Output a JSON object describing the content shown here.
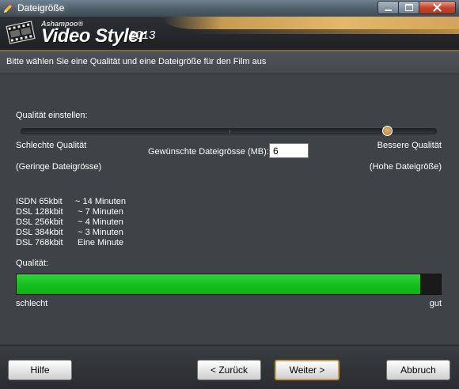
{
  "window": {
    "title": "Dateigröße",
    "title_icon": "pencil-icon",
    "controls": [
      "minimize-icon",
      "maximize-icon",
      "close-icon"
    ]
  },
  "banner": {
    "brand_small": "Ashampoo®",
    "brand_main": "Video Styler",
    "brand_year": "2013",
    "icon": "filmstrip-icon"
  },
  "instruction": "Bitte wählen Sie eine Qualität und eine Dateigröße für den Film aus",
  "quality_slider": {
    "label": "Qualität einstellen:",
    "min_label": "Schlechte Qualität",
    "max_label": "Bessere Qualität",
    "min_hint": "(Geringe Dateigrösse)",
    "max_hint": "(Hohe Dateigröße)",
    "value_fraction": 0.89
  },
  "file_size": {
    "label": "Gewünschte Dateigrösse (MB):",
    "value": "6"
  },
  "rates": [
    {
      "connection": "ISDN 65kbit",
      "time": "~ 14 Minuten"
    },
    {
      "connection": "DSL 128kbit",
      "time": "~ 7 Minuten"
    },
    {
      "connection": "DSL 256kbit",
      "time": "~ 4 Minuten"
    },
    {
      "connection": "DSL 384kbit",
      "time": "~ 3 Minuten"
    },
    {
      "connection": "DSL 768kbit",
      "time": "Eine Minute"
    }
  ],
  "quality_meter": {
    "label": "Qualität:",
    "low_label": "schlecht",
    "high_label": "gut",
    "fill_fraction": 0.952,
    "fill_color": "#1cc424"
  },
  "buttons": {
    "help": "Hilfe",
    "back": "< Zurück",
    "next": "Weiter >",
    "cancel": "Abbruch"
  },
  "colors": {
    "accent": "#c89a4c",
    "background": "#414549"
  }
}
